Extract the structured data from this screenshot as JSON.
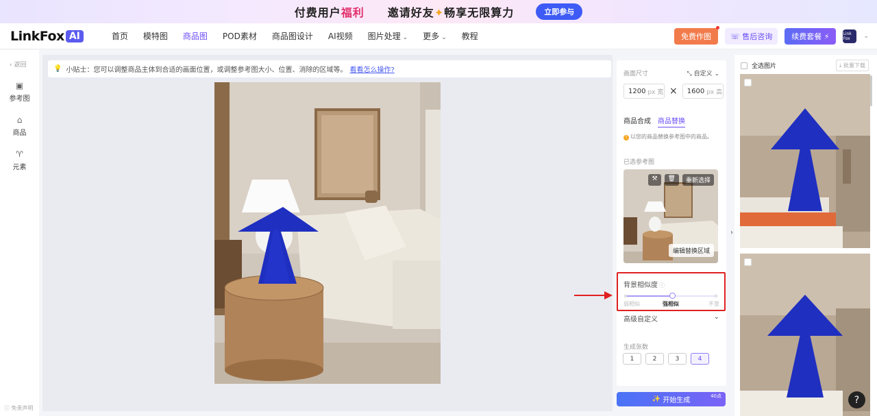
{
  "banner": {
    "part1": "付费用户",
    "part1_highlight": "福利",
    "part2": "邀请好友",
    "part2_rest": "畅享无限算力",
    "join_label": "立即参与"
  },
  "nav": {
    "logo_text": "LinkFox",
    "logo_badge": "AI",
    "items": [
      {
        "label": "首页"
      },
      {
        "label": "模特图"
      },
      {
        "label": "商品图",
        "active": true
      },
      {
        "label": "POD素材"
      },
      {
        "label": "商品图设计"
      },
      {
        "label": "AI视频"
      },
      {
        "label": "图片处理",
        "dropdown": true
      },
      {
        "label": "更多",
        "dropdown": true
      },
      {
        "label": "教程"
      }
    ],
    "free_label": "免费作图",
    "cs_label": "售后咨询",
    "renew_label": "续费套餐",
    "avatar_text": "Link Fox"
  },
  "rail": {
    "back_label": "返回",
    "items": [
      {
        "label": "参考图",
        "icon": "image-icon"
      },
      {
        "label": "商品",
        "icon": "bag-icon"
      },
      {
        "label": "元素",
        "icon": "trophy-icon"
      }
    ],
    "disclaimer": "免责声明"
  },
  "canvas": {
    "tip_text": "小贴士：您可以调整商品主体到合适的画面位置，或调整参考图大小、位置、消除的区域等。",
    "tip_link": "看看怎么操作?"
  },
  "settings": {
    "size_label": "画面尺寸",
    "size_mode": "自定义",
    "width": "1200",
    "height": "1600",
    "unit": "px 宽",
    "unit_h": "px 高",
    "tabs": [
      {
        "label": "商品合成"
      },
      {
        "label": "商品替换",
        "active": true
      }
    ],
    "note": "以您的商品替换参考图中的商品。",
    "ref_label": "已选参考图",
    "reselect_label": "重新选择",
    "edit_region_label": "编辑替换区域",
    "bg_similarity_label": "背景相似度",
    "slider_labels": [
      "弱相似",
      "强相似",
      "不变"
    ],
    "slider_value": 0.5,
    "advanced_label": "高级自定义",
    "count_label": "生成张数",
    "counts": [
      "1",
      "2",
      "3",
      "4"
    ],
    "count_selected": "4",
    "generate_label": "开始生成",
    "generate_cost": "40点"
  },
  "results": {
    "select_all_label": "全选图片",
    "batch_download_label": "批量下载"
  },
  "colors": {
    "accent": "#6a4cf5",
    "highlight_border": "#e02020",
    "lamp_blue": "#1f2fc0"
  }
}
